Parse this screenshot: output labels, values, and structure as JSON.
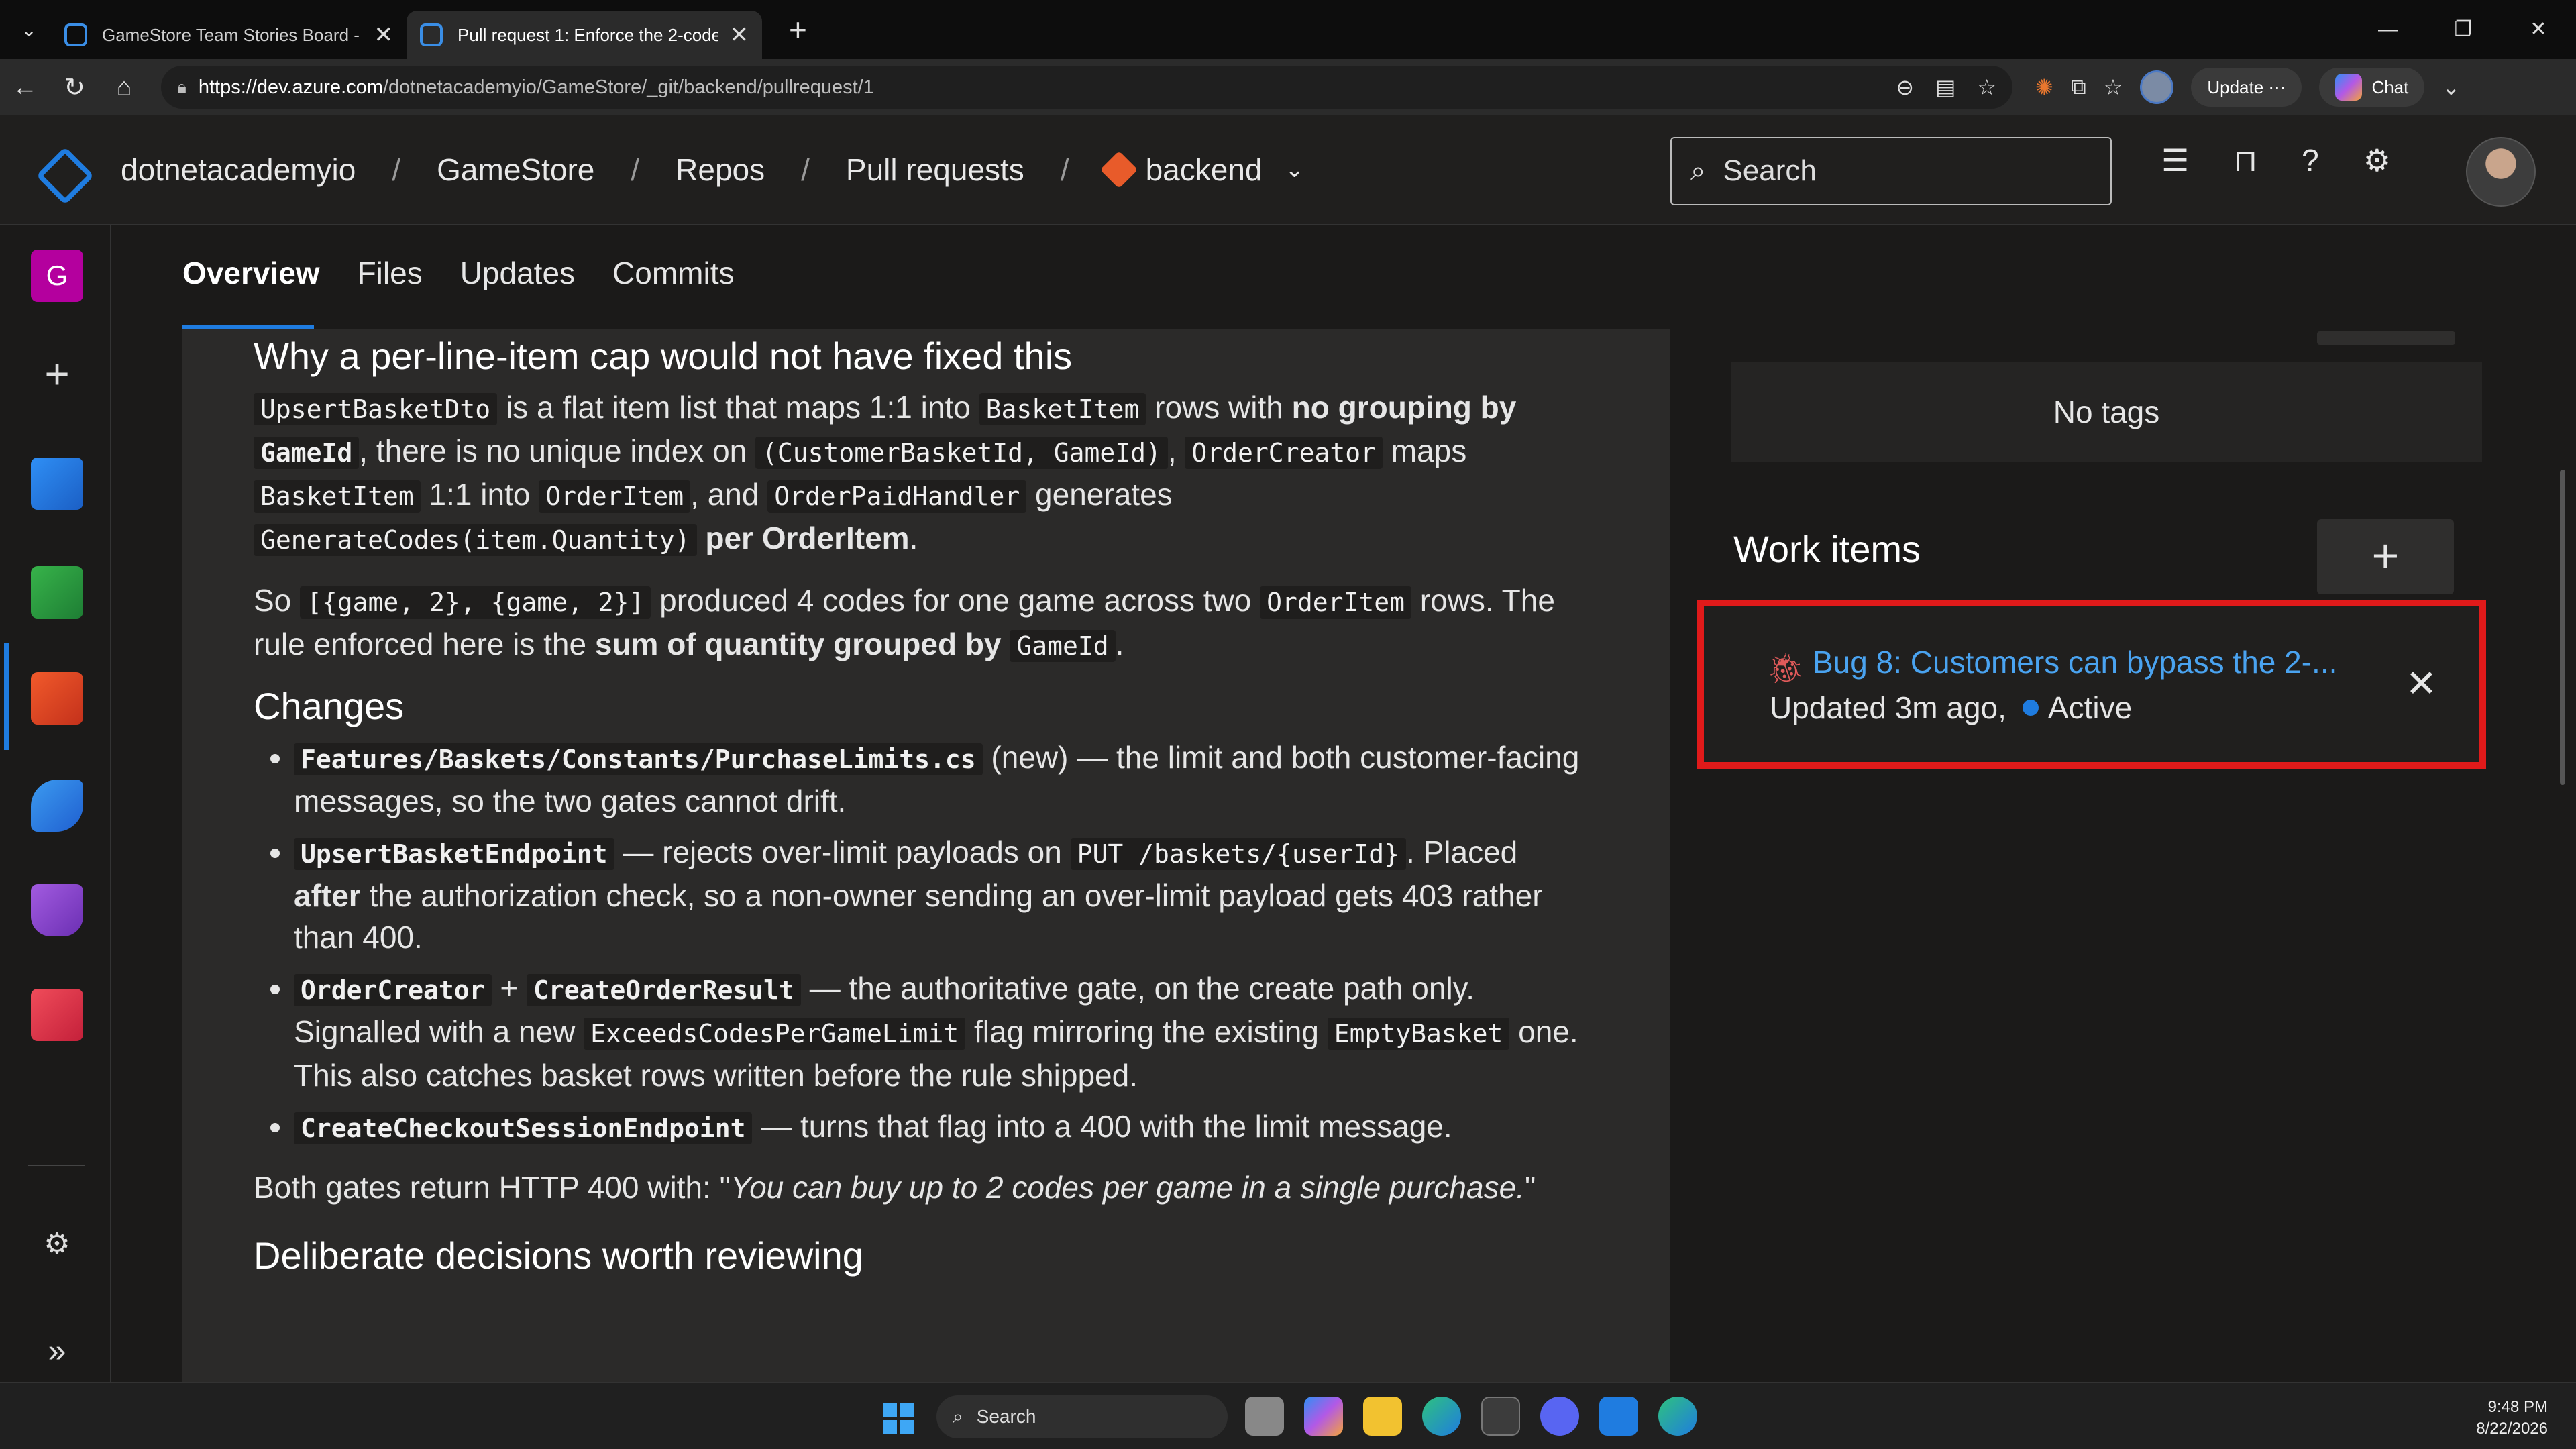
{
  "browser": {
    "tabs": [
      {
        "title": "GameStore Team Stories Board - B",
        "active": false
      },
      {
        "title": "Pull request 1: Enforce the 2-code",
        "active": true
      }
    ],
    "url_host": "https://dev.azure.com",
    "url_path": "/dotnetacademyio/GameStore/_git/backend/pullrequest/1",
    "update_label": "Update",
    "chat_label": "Chat"
  },
  "header": {
    "org": "dotnetacademyio",
    "project": "GameStore",
    "section": "Repos",
    "subsection": "Pull requests",
    "repo": "backend",
    "search_placeholder": "Search"
  },
  "rail": {
    "project_initial": "G"
  },
  "pr_tabs": [
    "Overview",
    "Files",
    "Updates",
    "Commits"
  ],
  "description": {
    "h_why": "Why a per-line-item cap would not have fixed this",
    "p1": {
      "c1": "UpsertBasketDto",
      "t1": " is a flat item list that maps 1:1 into ",
      "c2": "BasketItem",
      "t2": " rows with ",
      "b1": "no grouping by",
      "c3": "GameId",
      "t3": ", there is no unique index on ",
      "c4": "(CustomerBasketId, GameId)",
      "t4": ", ",
      "c5": "OrderCreator",
      "t5": " maps ",
      "c6": "BasketItem",
      "t6": " 1:1 into ",
      "c7": "OrderItem",
      "t7": ", and ",
      "c8": "OrderPaidHandler",
      "t8": " generates ",
      "c9": "GenerateCodes(item.Quantity)",
      "b2": "per OrderItem",
      "t9": "."
    },
    "p2": {
      "t1": "So ",
      "c1": "[{game, 2}, {game, 2}]",
      "t2": " produced 4 codes for one game across two ",
      "c2": "OrderItem",
      "t3": " rows. The rule enforced here is the ",
      "b1": "sum of quantity grouped by",
      "c3": "GameId",
      "t4": "."
    },
    "h_changes": "Changes",
    "changes": {
      "i1": {
        "c1": "Features/Baskets/Constants/PurchaseLimits.cs",
        "t1": " (new) — the limit and both customer-facing messages, so the two gates cannot drift."
      },
      "i2": {
        "c1": "UpsertBasketEndpoint",
        "t1": " — rejects over-limit payloads on ",
        "c2": "PUT /baskets/{userId}",
        "t2": ". Placed ",
        "b1": "after",
        "t3": " the authorization check, so a non-owner sending an over-limit payload gets 403 rather than 400."
      },
      "i3": {
        "c1": "OrderCreator",
        "t1": " + ",
        "c2": "CreateOrderResult",
        "t2": " — the authoritative gate, on the create path only. Signalled with a new ",
        "c3": "ExceedsCodesPerGameLimit",
        "t3": " flag mirroring the existing ",
        "c4": "EmptyBasket",
        "t4": " one. This also catches basket rows written before the rule shipped."
      },
      "i4": {
        "c1": "CreateCheckoutSessionEndpoint",
        "t1": " — turns that flag into a 400 with the limit message."
      }
    },
    "p3": {
      "t1": "Both gates return HTTP 400 with: \"",
      "em": "You can buy up to 2 codes per game in a single purchase.",
      "t2": "\""
    },
    "h_decisions": "Deliberate decisions worth reviewing"
  },
  "side": {
    "no_tags": "No tags",
    "work_items_title": "Work items",
    "add_label": "+",
    "work_item": {
      "title": "Bug 8: Customers can bypass the 2-...",
      "updated": "Updated 3m ago,",
      "state": "Active"
    }
  },
  "taskbar": {
    "search_placeholder": "Search",
    "time": "9:48 PM",
    "date": "8/22/2026"
  },
  "colors": {
    "accent": "#1f7ce0",
    "highlight_border": "#e01a1a",
    "link": "#4aa3f0"
  }
}
